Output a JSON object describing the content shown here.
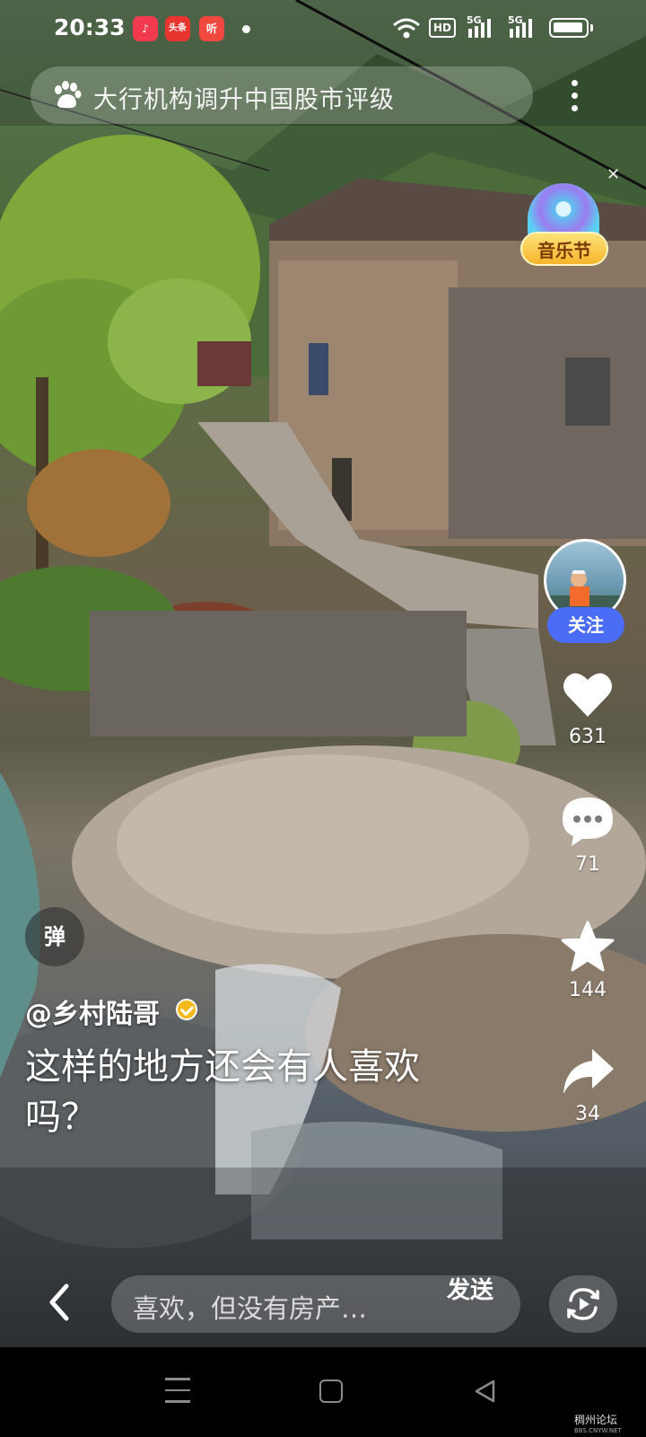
{
  "status_bar": {
    "time": "20:33",
    "app_icons": [
      {
        "name": "music-app-icon",
        "label": "♪",
        "color": "#f23a4e"
      },
      {
        "name": "toutiao-app-icon",
        "label": "头条",
        "color": "#e8352f"
      },
      {
        "name": "listen-app-icon",
        "label": "听",
        "color": "#f0483e"
      }
    ],
    "hd_label": "HD",
    "signal_labels": [
      "5G",
      "5G"
    ]
  },
  "search": {
    "text": "大行机构调升中国股市评级"
  },
  "music_badge": {
    "label": "音乐节"
  },
  "sidebar_actions": {
    "follow_label": "关注",
    "likes": "631",
    "comments": "71",
    "favorites": "144",
    "shares": "34"
  },
  "danmaku": {
    "label": "弹"
  },
  "caption": {
    "author": "@乡村陆哥",
    "description": "这样的地方还会有人喜欢吗？"
  },
  "comment_bar": {
    "placeholder": "喜欢，但没有房产…",
    "send_label": "发送"
  },
  "watermark": {
    "title": "稠州论坛",
    "url": "BBS.CNYW.NET"
  },
  "colors": {
    "follow_blue": "#4a6cf7",
    "badge_gold": "#f5b52b",
    "verified_gold": "#f3b81c"
  }
}
